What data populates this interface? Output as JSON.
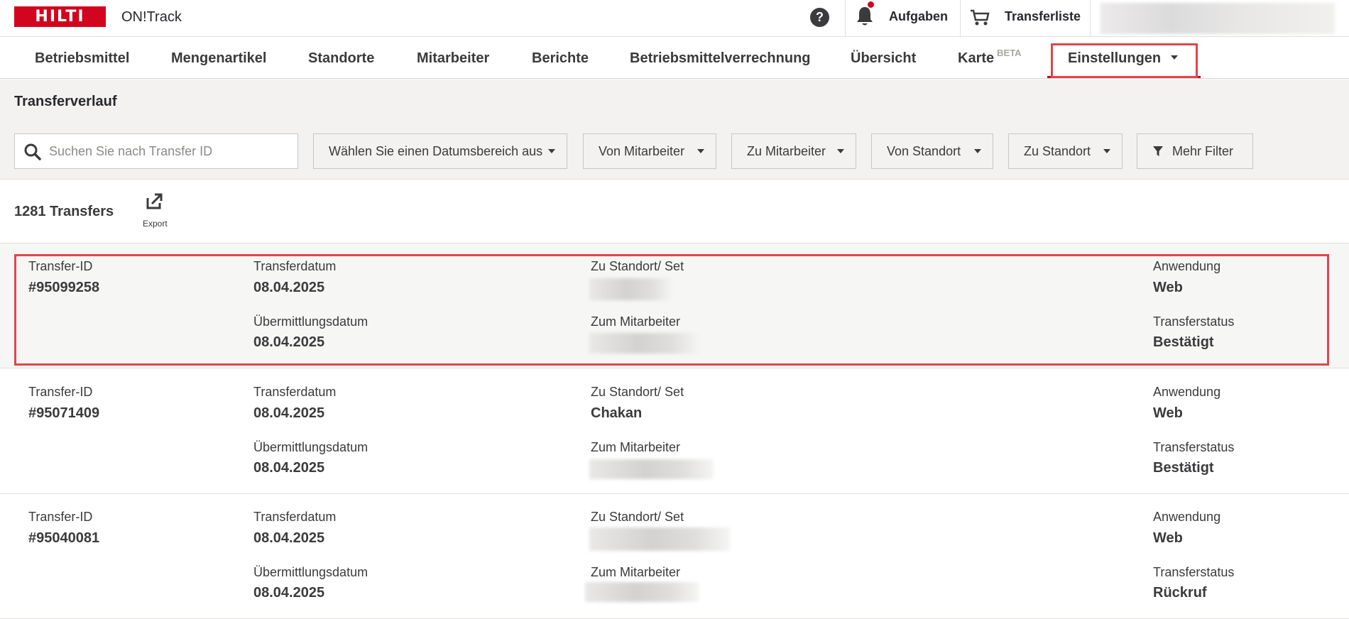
{
  "topbar": {
    "logo": "HILTI",
    "app_name": "ON!Track",
    "help_glyph": "?",
    "tasks_label": "Aufgaben",
    "transferlist_label": "Transferliste"
  },
  "nav": {
    "items": [
      "Betriebsmittel",
      "Mengenartikel",
      "Standorte",
      "Mitarbeiter",
      "Berichte",
      "Betriebsmittelverrechnung",
      "Übersicht",
      "Karte",
      "Einstellungen"
    ],
    "beta_badge": "BETA"
  },
  "page": {
    "title": "Transferverlauf"
  },
  "search": {
    "placeholder": "Suchen Sie nach Transfer ID"
  },
  "filters": {
    "date_range": "Wählen Sie einen Datumsbereich aus",
    "from_employee": "Von Mitarbeiter",
    "to_employee": "Zu Mitarbeiter",
    "from_location": "Von Standort",
    "to_location": "Zu Standort",
    "more_filters": "Mehr Filter"
  },
  "summary": {
    "count": "1281 Transfers",
    "export_label": "Export"
  },
  "labels": {
    "transfer_id": "Transfer-ID",
    "transfer_date": "Transferdatum",
    "submission_date": "Übermittlungsdatum",
    "to_location": "Zu Standort/ Set",
    "to_employee": "Zum Mitarbeiter",
    "application": "Anwendung",
    "status": "Transferstatus"
  },
  "transfers": [
    {
      "id": "#95099258",
      "transfer_date": "08.04.2025",
      "submission_date": "08.04.2025",
      "to_location": "",
      "application": "Web",
      "status": "Bestätigt"
    },
    {
      "id": "#95071409",
      "transfer_date": "08.04.2025",
      "submission_date": "08.04.2025",
      "to_location": "Chakan",
      "application": "Web",
      "status": "Bestätigt"
    },
    {
      "id": "#95040081",
      "transfer_date": "08.04.2025",
      "submission_date": "08.04.2025",
      "to_location": "",
      "application": "Web",
      "status": "Rückruf"
    }
  ],
  "colors": {
    "brand_red": "#d2051e",
    "highlight_outline": "#e0454d"
  }
}
